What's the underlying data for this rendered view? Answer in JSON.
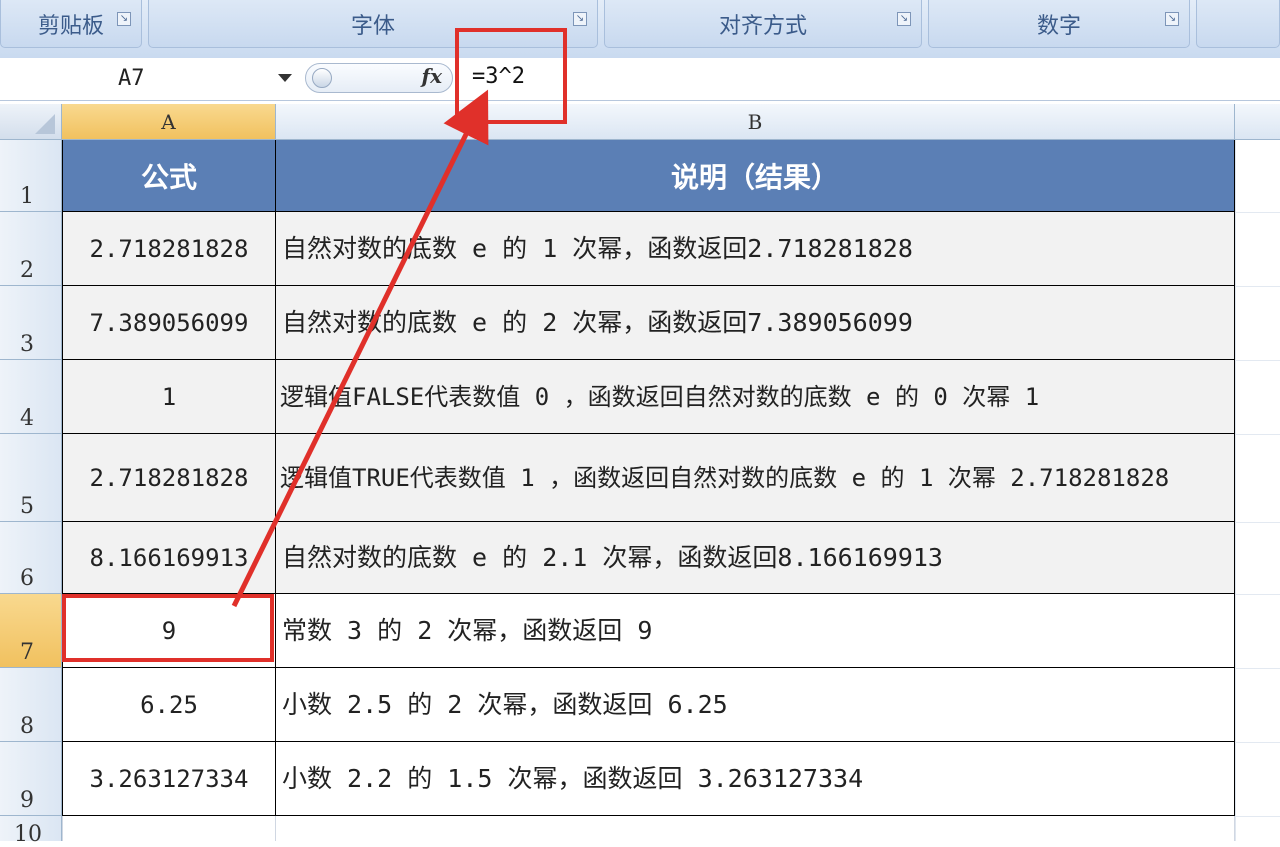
{
  "ribbon": {
    "groups": [
      {
        "label": "剪贴板"
      },
      {
        "label": "字体"
      },
      {
        "label": "对齐方式"
      },
      {
        "label": "数字"
      }
    ],
    "launcher_icon": "dialog-launcher-icon"
  },
  "formula_bar": {
    "name_box": "A7",
    "fx_label": "fx",
    "formula": "=3^2"
  },
  "columns": [
    "A",
    "B"
  ],
  "rows": [
    {
      "num": "1",
      "a": "公式",
      "b": "说明（结果）"
    },
    {
      "num": "2",
      "a": "2.718281828",
      "b": "自然对数的底数 e 的 1 次幂，函数返回2.718281828"
    },
    {
      "num": "3",
      "a": "7.389056099",
      "b": "自然对数的底数 e 的 2 次幂，函数返回7.389056099"
    },
    {
      "num": "4",
      "a": "1",
      "b": "逻辑值FALSE代表数值 0 ，函数返回自然对数的底数 e 的 0 次幂 1"
    },
    {
      "num": "5",
      "a": "2.718281828",
      "b": "逻辑值TRUE代表数值 1 ，函数返回自然对数的底数 e 的 1 次幂 2.718281828"
    },
    {
      "num": "6",
      "a": "8.166169913",
      "b": "自然对数的底数 e 的 2.1 次幂，函数返回8.166169913"
    },
    {
      "num": "7",
      "a": "9",
      "b": "常数 3 的 2 次幂，函数返回 9"
    },
    {
      "num": "8",
      "a": "6.25",
      "b": "小数 2.5 的 2 次幂，函数返回 6.25"
    },
    {
      "num": "9",
      "a": "3.263127334",
      "b": "小数 2.2 的 1.5 次幂，函数返回 3.263127334"
    },
    {
      "num": "10",
      "a": "",
      "b": ""
    }
  ],
  "selected_cell": "A7",
  "colors": {
    "header_fill": "#5b7fb5",
    "highlight": "#e0302a",
    "selection": "#f1c15f"
  }
}
